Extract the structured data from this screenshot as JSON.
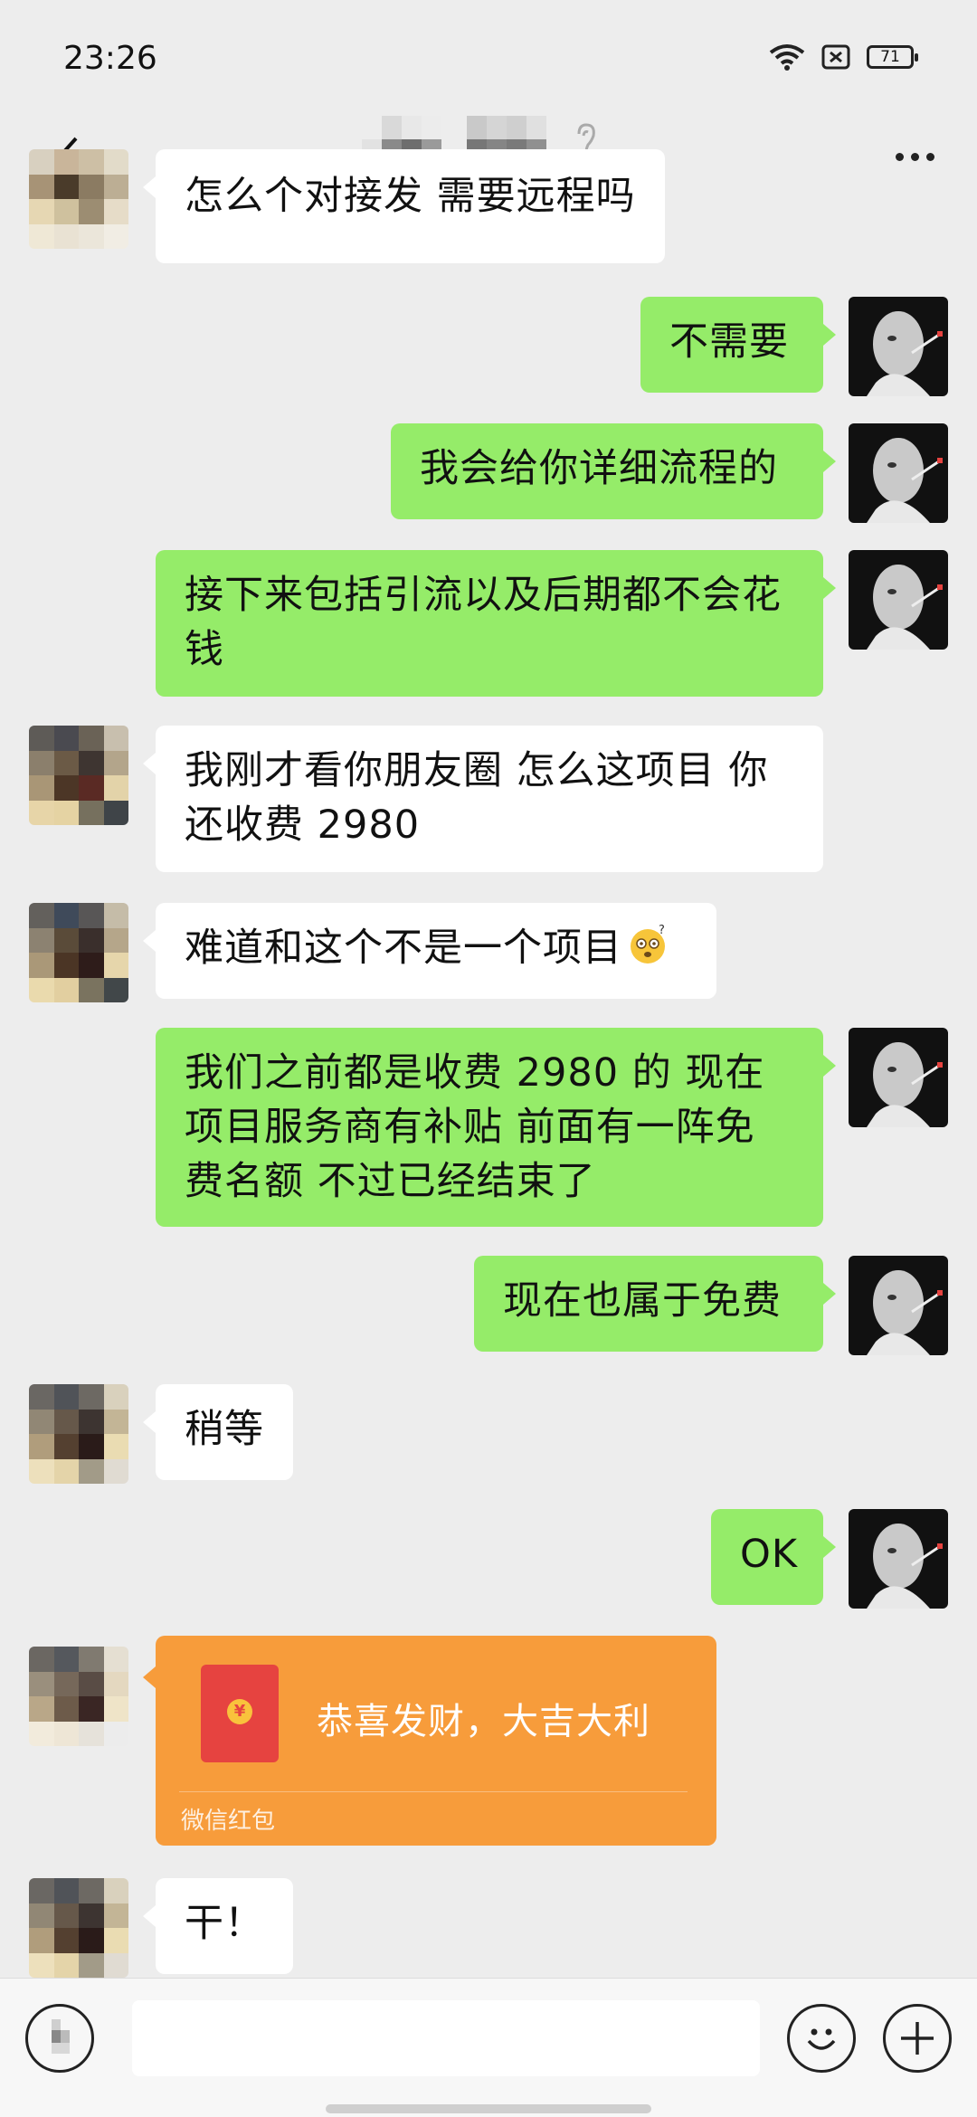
{
  "status_bar": {
    "time": "23:26",
    "battery": "71",
    "icons": [
      "wifi-icon",
      "data-icon",
      "battery-icon"
    ]
  },
  "nav": {
    "back_icon": "chevron-left-icon",
    "title": "",
    "more_icon": "more-dots-icon",
    "mute_icon": "ear-icon"
  },
  "messages": [
    {
      "side": "left",
      "text": "怎么个对接发  需要远程吗"
    },
    {
      "side": "right",
      "text": "不需要"
    },
    {
      "side": "right",
      "text": "我会给你详细流程的"
    },
    {
      "side": "right",
      "text": "接下来包括引流以及后期都不会花钱"
    },
    {
      "side": "left",
      "text": "我刚才看你朋友圈  怎么这项目 你还收费 2980"
    },
    {
      "side": "left",
      "text": "难道和这个不是一个项目"
    },
    {
      "side": "right",
      "text": "我们之前都是收费 2980 的   现在项目服务商有补贴  前面有一阵免费名额  不过已经结束了"
    },
    {
      "side": "right",
      "text": "现在也属于免费"
    },
    {
      "side": "left",
      "text": "稍等"
    },
    {
      "side": "right",
      "text": "OK"
    },
    {
      "side": "left",
      "type": "red_packet",
      "title": "恭喜发财，大吉大利",
      "label": "微信红包",
      "coin": "¥"
    },
    {
      "side": "left",
      "text": "干！"
    }
  ],
  "input": {
    "placeholder": "",
    "voice_icon": "voice-icon",
    "emoji_icon": "emoji-icon",
    "plus_icon": "plus-icon"
  },
  "colors": {
    "background": "#ededed",
    "sent_bubble": "#95ec69",
    "received_bubble": "#ffffff",
    "red_packet": "#f79c3b",
    "envelope": "#e64340"
  }
}
